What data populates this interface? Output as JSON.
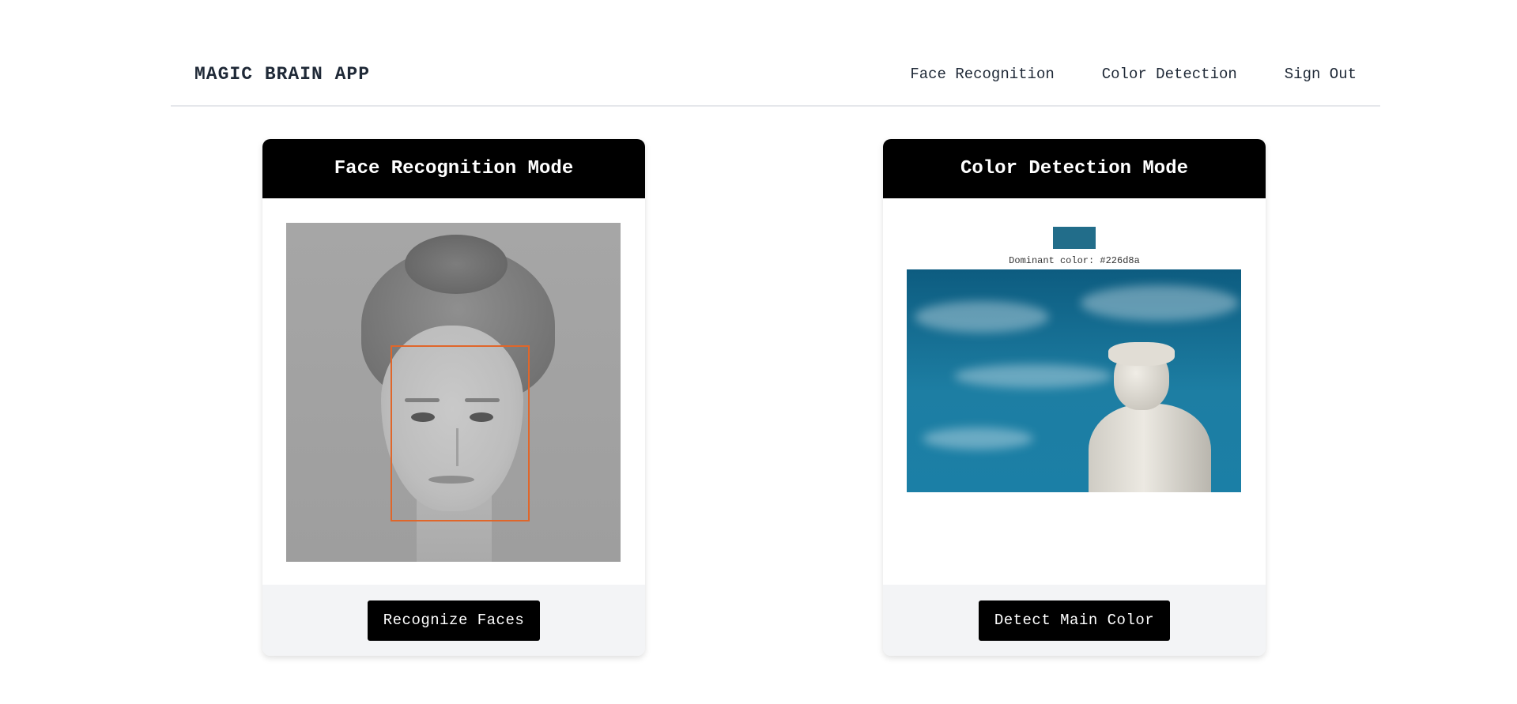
{
  "header": {
    "brand": "MAGIC BRAIN APP",
    "nav": [
      {
        "label": "Face Recognition"
      },
      {
        "label": "Color Detection"
      },
      {
        "label": "Sign Out"
      }
    ]
  },
  "face_card": {
    "title": "Face Recognition Mode",
    "button_label": "Recognize Faces",
    "box_color": "#e0662a"
  },
  "color_card": {
    "title": "Color Detection Mode",
    "dominant_label": "Dominant color: #226d8a",
    "dominant_hex": "#226d8a",
    "button_label": "Detect Main Color"
  }
}
